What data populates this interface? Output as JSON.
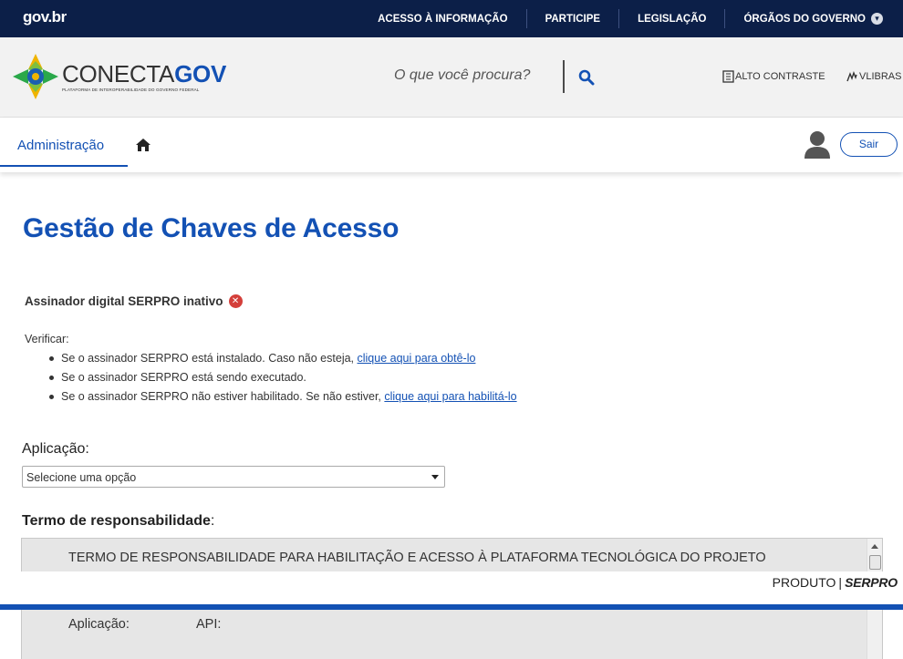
{
  "govbar": {
    "logo": "gov.br",
    "links": [
      "ACESSO À INFORMAÇÃO",
      "PARTICIPE",
      "LEGISLAÇÃO",
      "ÓRGÃOS DO GOVERNO"
    ]
  },
  "header": {
    "brand_prefix": "CONECTA",
    "brand_suffix": "GOV",
    "brand_subtitle": "PLATAFORMA DE INTEROPERABILIDADE DO GOVERNO FEDERAL",
    "search_placeholder": "O que você procura?",
    "contrast_label": "ALTO CONTRASTE",
    "vlibras_label": "VLIBRAS"
  },
  "nav": {
    "tab_admin": "Administração",
    "logout": "Sair"
  },
  "main": {
    "title": "Gestão de Chaves de Acesso",
    "status": "Assinador digital SERPRO inativo",
    "verify_label": "Verificar:",
    "verify_items": [
      {
        "text": "Se o assinador SERPRO está instalado. Caso não esteja, ",
        "link": "clique aqui para obtê-lo"
      },
      {
        "text": "Se o assinador SERPRO está sendo executado.",
        "link": ""
      },
      {
        "text": "Se o assinador SERPRO não estiver habilitado. Se não estiver, ",
        "link": "clique aqui para habilitá-lo"
      }
    ],
    "app_label": "Aplicação",
    "app_select": "Selecione uma opção",
    "terms_label": "Termo de responsabilidade",
    "terms_heading": "TERMO DE RESPONSABILIDADE PARA HABILITAÇÃO E ACESSO À PLATAFORMA TECNOLÓGICA DO PROJETO",
    "terms_app_label": "Aplicação:",
    "terms_api_label": "API:"
  },
  "footer": {
    "produto": "PRODUTO",
    "serpro": "SERPRO"
  }
}
